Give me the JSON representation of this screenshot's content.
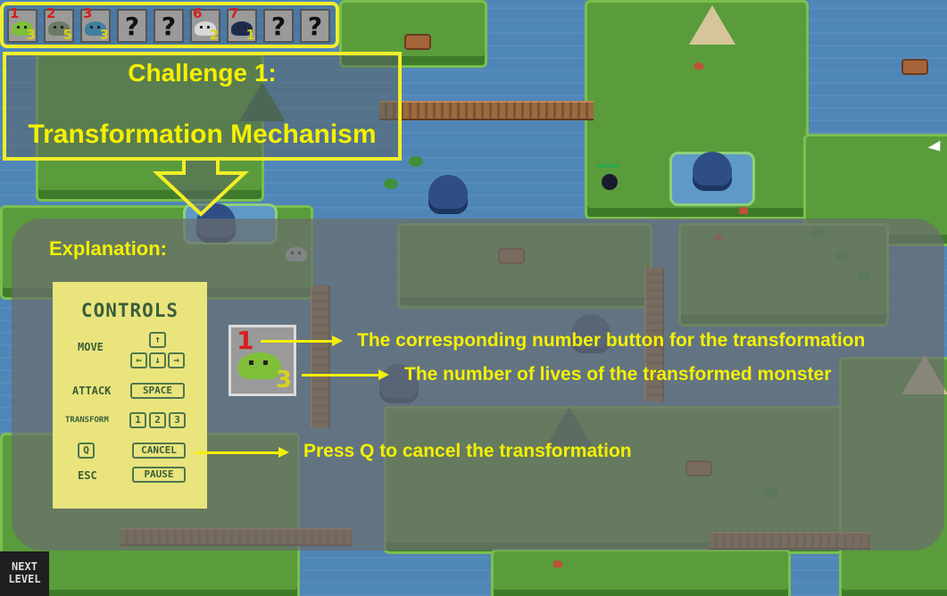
{
  "hotbar": {
    "slots": [
      {
        "number": "1",
        "lives": "3",
        "monster": "green-slime"
      },
      {
        "number": "2",
        "lives": "5",
        "monster": "gray-slime"
      },
      {
        "number": "3",
        "lives": "3",
        "monster": "blue-slime"
      },
      {
        "number": "",
        "lives": "",
        "monster": "locked",
        "symbol": "?"
      },
      {
        "number": "",
        "lives": "",
        "monster": "locked",
        "symbol": "?"
      },
      {
        "number": "6",
        "lives": "2",
        "monster": "ghost"
      },
      {
        "number": "7",
        "lives": "1",
        "monster": "dark-bird"
      },
      {
        "number": "",
        "lives": "",
        "monster": "locked",
        "symbol": "?"
      },
      {
        "number": "",
        "lives": "",
        "monster": "locked",
        "symbol": "?"
      }
    ]
  },
  "challenge": {
    "title_line1": "Challenge 1:",
    "title_line2": "Transformation Mechanism"
  },
  "explanation": {
    "heading": "Explanation:",
    "controls": {
      "title": "CONTROLS",
      "move_label": "MOVE",
      "attack_label": "ATTACK",
      "attack_key": "SPACE",
      "transform_label": "TRANSFORM",
      "transform_keys": [
        "1",
        "2",
        "3"
      ],
      "cancel_key_label": "Q",
      "cancel_key": "CANCEL",
      "pause_label": "ESC",
      "pause_key": "PAUSE"
    },
    "example_card": {
      "number": "1",
      "lives": "3"
    },
    "notes": {
      "number_note": "The corresponding number button for the transformation",
      "lives_note": "The number of lives of the transformed monster",
      "cancel_note": "Press Q to cancel the transformation"
    }
  },
  "next_level": {
    "line1": "NEXT",
    "line2": "LEVEL"
  },
  "colors": {
    "highlight": "#f4f000",
    "slot_number": "#d42020",
    "lives": "#d6d21e",
    "panel": "#eae47d"
  }
}
